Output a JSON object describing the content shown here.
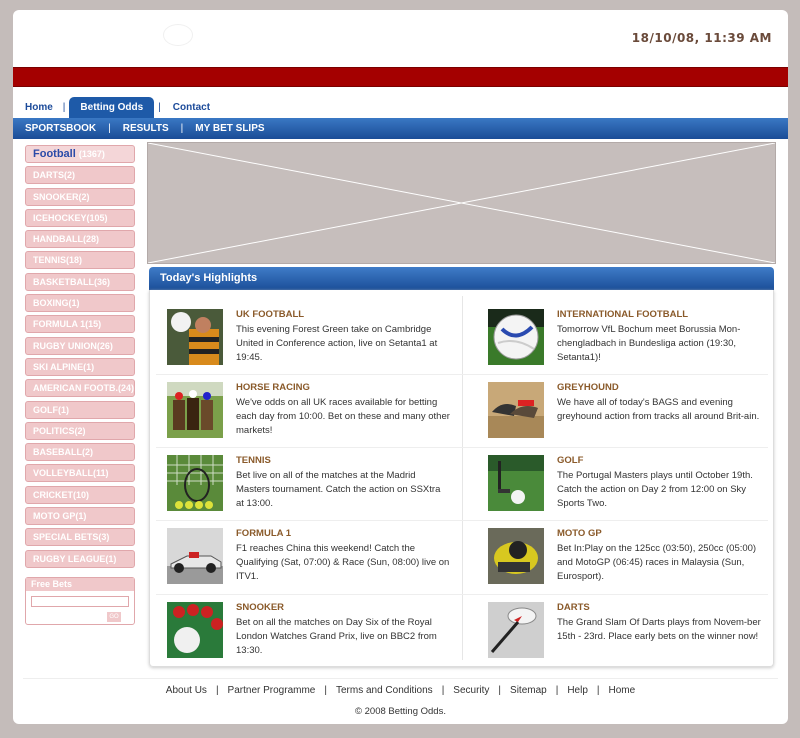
{
  "header": {
    "datetime": "18/10/08, 11:39 AM"
  },
  "topnav": {
    "tabs": [
      "Home",
      "Betting Odds",
      "Contact"
    ]
  },
  "subnav": {
    "links": [
      "SPORTSBOOK",
      "RESULTS",
      "MY BET SLIPS"
    ]
  },
  "sidebar": {
    "first": {
      "label": "Football",
      "count": "(1367)"
    },
    "sports": [
      "DARTS(2)",
      "SNOOKER(2)",
      "ICEHOCKEY(105)",
      "HANDBALL(28)",
      "TENNIS(18)",
      "BASKETBALL(36)",
      "BOXING(1)",
      "FORMULA 1(15)",
      "RUGBY UNION(26)",
      "SKI ALPINE(1)",
      "AMERICAN FOOTB.(24)",
      "GOLF(1)",
      "POLITICS(2)",
      "BASEBALL(2)",
      "VOLLEYBALL(11)",
      "CRICKET(10)",
      "MOTO GP(1)",
      "SPECIAL BETS(3)",
      "RUGBY LEAGUE(1)"
    ]
  },
  "freebets": {
    "label": "Free Bets",
    "go": "GO"
  },
  "highlights": {
    "title": "Today's Highlights",
    "items": [
      {
        "title": "UK FOOTBALL",
        "text": "This evening Forest Green take on Cambridge United in Conference action, live on Setanta1 at 19:45.",
        "icon": "football-player-photo"
      },
      {
        "title": "INTERNATIONAL FOOTBALL",
        "text": "Tomorrow VfL Bochum meet Borussia Mon-chengladbach in Bundesliga action (19:30, Setanta1)!",
        "icon": "soccer-ball-photo"
      },
      {
        "title": "HORSE RACING",
        "text": "We've odds on all UK races available for betting each day from 10:00. Bet on these and many other markets!",
        "icon": "horse-racing-photo"
      },
      {
        "title": "GREYHOUND",
        "text": "We have all of today's BAGS and evening greyhound action from tracks all around Brit-ain.",
        "icon": "greyhound-photo"
      },
      {
        "title": "TENNIS",
        "text": "Bet live on all of the matches at the Madrid Masters tournament. Catch the action on SSXtra at 13:00.",
        "icon": "tennis-photo"
      },
      {
        "title": "GOLF",
        "text": "The Portugal Masters plays until October 19th. Catch the action on Day 2 from 12:00 on Sky Sports Two.",
        "icon": "golf-photo"
      },
      {
        "title": "FORMULA 1",
        "text": "F1 reaches China this weekend! Catch the Qualifying (Sat, 07:00) & Race (Sun, 08:00) live on ITV1.",
        "icon": "f1-car-photo"
      },
      {
        "title": "MOTO GP",
        "text": "Bet In:Play on the 125cc (03:50), 250cc (05:00) and MotoGP (06:45) races in Malaysia (Sun, Eurosport).",
        "icon": "motogp-photo"
      },
      {
        "title": "SNOOKER",
        "text": "Bet on all the matches on Day Six of the Royal London Watches Grand Prix, live on BBC2 from 13:30.",
        "icon": "snooker-photo"
      },
      {
        "title": "DARTS",
        "text": "The Grand Slam Of Darts plays from Novem-ber 15th - 23rd. Place early bets on the winner now!",
        "icon": "darts-photo"
      }
    ]
  },
  "footer": {
    "links": [
      "About Us",
      "Partner Programme",
      "Terms and Conditions",
      "Security",
      "Sitemap",
      "Help",
      "Home"
    ],
    "copyright": "© 2008 Betting Odds."
  }
}
